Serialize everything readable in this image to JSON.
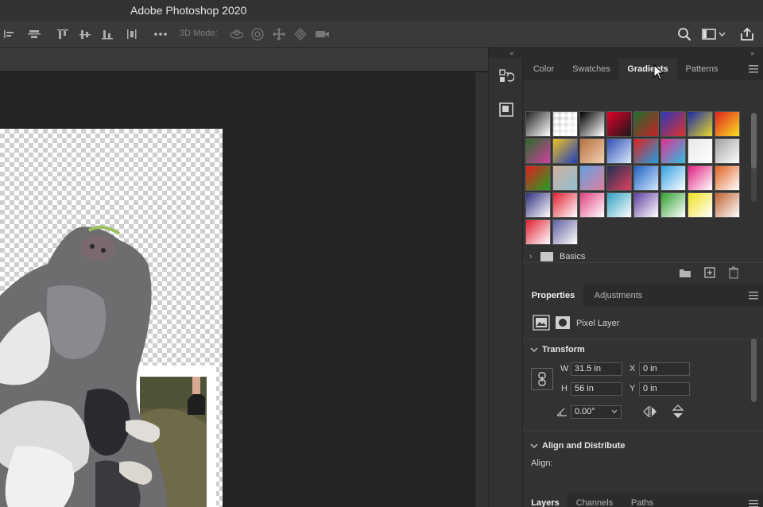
{
  "app": {
    "title": "Adobe Photoshop 2020"
  },
  "options_bar": {
    "three_d_mode_label": "3D Mode:"
  },
  "colors": {
    "bg_dark": "#1e1e1e",
    "panel": "#323232",
    "tab_bar": "#2b2b2b",
    "text_primary": "#e6e6e6"
  },
  "swatches_panel": {
    "tabs": [
      {
        "label": "Color",
        "active": false
      },
      {
        "label": "Swatches",
        "active": false
      },
      {
        "label": "Gradients",
        "active": true
      },
      {
        "label": "Patterns",
        "active": false
      }
    ],
    "gradients": [
      [
        "#222222",
        "#ffffff"
      ],
      [
        "transparent",
        "#ffffff"
      ],
      [
        "#000000",
        "#ffffff"
      ],
      [
        "#e00028",
        "#1a1a1a"
      ],
      [
        "#1f6e2a",
        "#c8202a"
      ],
      [
        "#2a3ab8",
        "#e03030"
      ],
      [
        "#1a2aa8",
        "#e8d828"
      ],
      [
        "#e02020",
        "#f8e020"
      ],
      [
        "#2a6a2a",
        "#d040a0"
      ],
      [
        "#f0c020",
        "#2040c0"
      ],
      [
        "#b87040",
        "#f0d0b0"
      ],
      [
        "#3050b0",
        "#d8e8ff"
      ],
      [
        "#e02020",
        "#20a0e0"
      ],
      [
        "#e03090",
        "#30c0e0"
      ],
      [
        "#e8e8e8",
        "#ffffff"
      ],
      [
        "#a0a0a0",
        "#ffffff"
      ],
      [
        "#e02020",
        "#20a020"
      ],
      [
        "#d0b0a0",
        "#90c0d0"
      ],
      [
        "#60a0e0",
        "#e080a0"
      ],
      [
        "#203050",
        "#e04060"
      ],
      [
        "#2060c0",
        "#d0e8ff"
      ],
      [
        "#30a0e0",
        "#ffffff"
      ],
      [
        "#e02080",
        "#ffffff"
      ],
      [
        "#e06020",
        "#ffffff"
      ],
      [
        "#303080",
        "#ffffff"
      ],
      [
        "#e02030",
        "#ffffff"
      ],
      [
        "#e04080",
        "#ffffff"
      ],
      [
        "#30a0c0",
        "#ffffff"
      ],
      [
        "#6040a0",
        "#ffffff"
      ],
      [
        "#30a030",
        "#ffffff"
      ],
      [
        "#f0e020",
        "#ffffff"
      ],
      [
        "#c06030",
        "#ffffff"
      ],
      [
        "#e02030",
        "#ffffff"
      ],
      [
        "#6060a0",
        "#ffffff"
      ]
    ],
    "folder_label": "Basics"
  },
  "properties_panel": {
    "tabs": [
      {
        "label": "Properties",
        "active": true
      },
      {
        "label": "Adjustments",
        "active": false
      }
    ],
    "layer_type": "Pixel Layer",
    "transform_title": "Transform",
    "w_label": "W",
    "w_value": "31.5 in",
    "h_label": "H",
    "h_value": "56 in",
    "x_label": "X",
    "x_value": "0 in",
    "y_label": "Y",
    "y_value": "0 in",
    "angle_value": "0.00°",
    "align_title": "Align and Distribute",
    "align_label": "Align:"
  },
  "layers_panel": {
    "tabs": [
      {
        "label": "Layers",
        "active": true
      },
      {
        "label": "Channels",
        "active": false
      },
      {
        "label": "Paths",
        "active": false
      }
    ]
  }
}
